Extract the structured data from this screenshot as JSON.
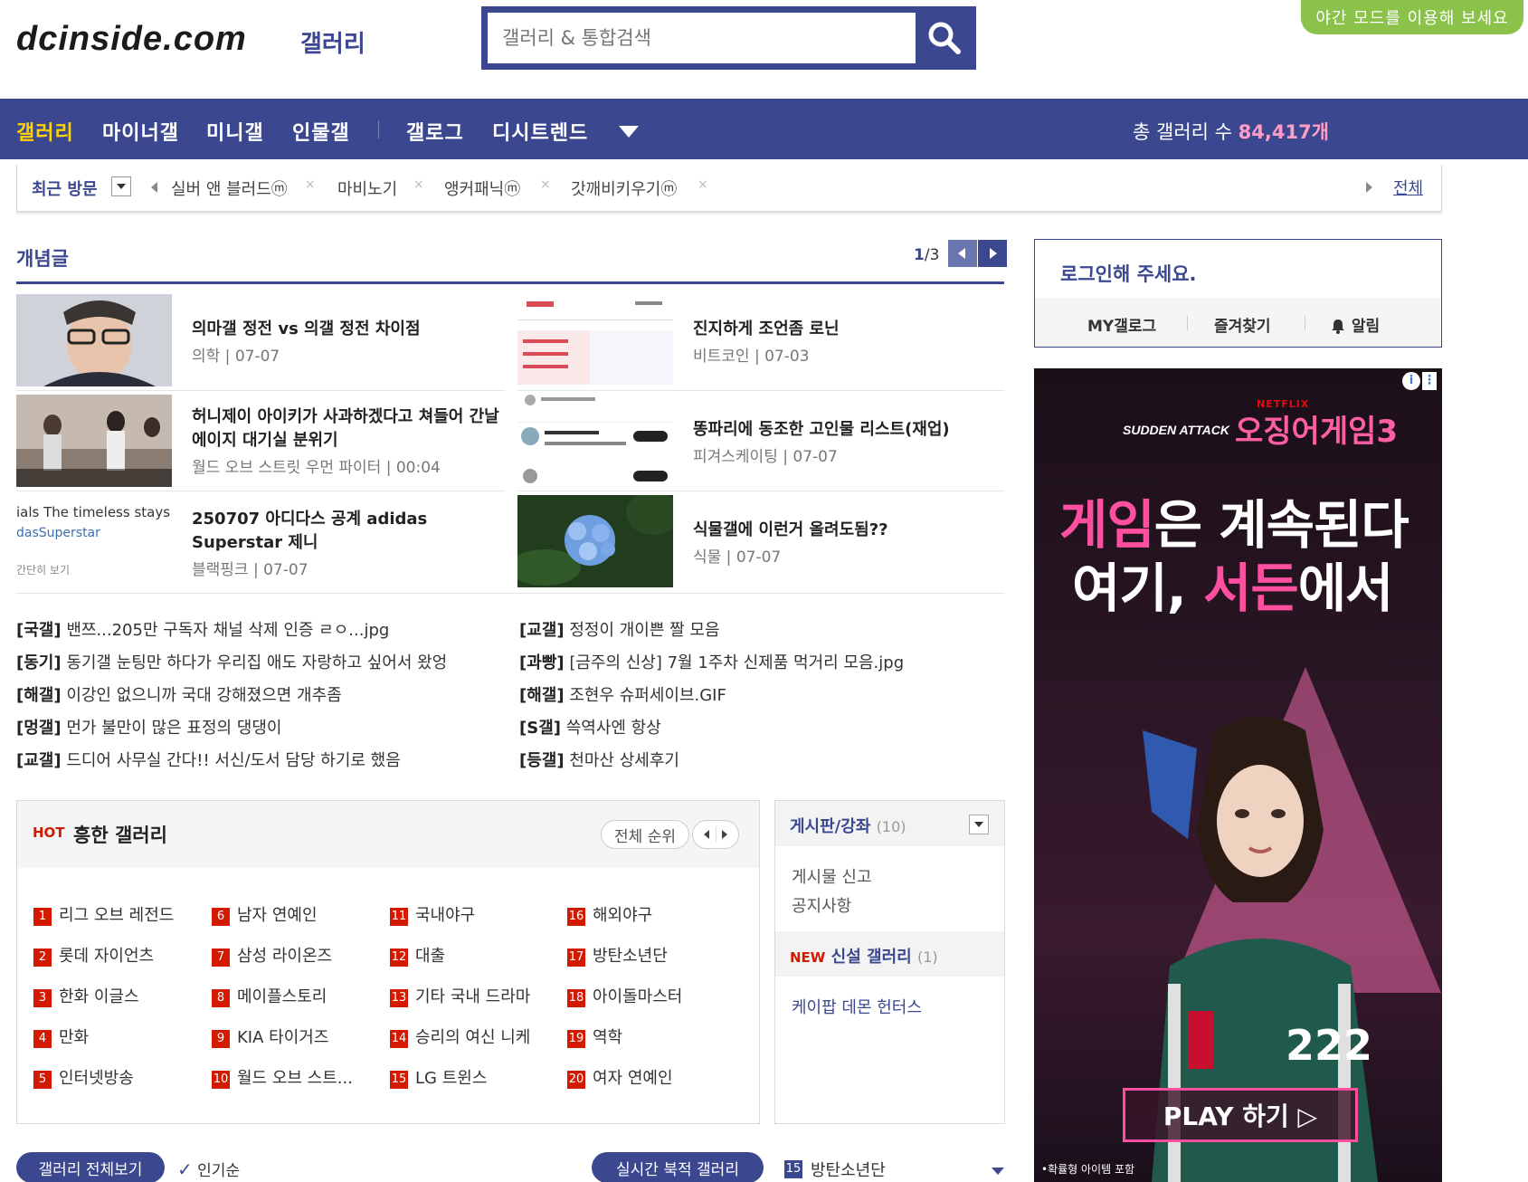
{
  "header": {
    "logo": "dcinside.com",
    "logo_sub": "갤러리",
    "search_placeholder": "갤러리 & 통합검색",
    "night_mode": "야간 모드를 이용해 보세요"
  },
  "nav": {
    "items": [
      "갤러리",
      "마이너갤",
      "미니갤",
      "인물갤",
      "갤로그",
      "디시트렌드"
    ],
    "total_label": "총 갤러리 수",
    "total_count": "84,417개"
  },
  "recent": {
    "label": "최근 방문",
    "items": [
      "실버 앤 블러드ⓜ",
      "마비노기",
      "앵커패닉ⓜ",
      "갓깨비키우기ⓜ"
    ],
    "remove": "×",
    "all": "전체"
  },
  "concept": {
    "title": "개념글",
    "page_current": "1",
    "page_total": "/3",
    "cards": [
      {
        "title": "의마갤 정전 vs 의갤 정전 차이점",
        "gallery": "의학",
        "date": "07-07"
      },
      {
        "title": "진지하게 조언좀 로닌",
        "gallery": "비트코인",
        "date": "07-03"
      },
      {
        "title": "허니제이 아이키가 사과하겠다고 쳐들어 간날 에이지 대기실 분위기",
        "gallery": "월드 오브 스트릿 우먼 파이터",
        "date": "00:04"
      },
      {
        "title": "똥파리에 동조한 고인물 리스트(재업)",
        "gallery": "피겨스케이팅",
        "date": "07-07"
      },
      {
        "title": "250707 아디다스 공계 adidas Superstar 제니",
        "gallery": "블랙핑크",
        "date": "07-07"
      },
      {
        "title": "식물갤에 이런거 올려도됨??",
        "gallery": "식물",
        "date": "07-07"
      }
    ],
    "thumb_texts": {
      "adidas_line1": "ials The timeless stays",
      "adidas_line2": "dasSuperstar",
      "adidas_line3": "간단히 보기"
    },
    "list_left": [
      {
        "tag": "[국갤]",
        "text": "밴쯔...205만 구독자 채널 삭제 인증 ㄹㅇ...jpg"
      },
      {
        "tag": "[동기]",
        "text": "동기갤 눈팅만 하다가 우리집 애도 자랑하고 싶어서 왔엉"
      },
      {
        "tag": "[해갤]",
        "text": "이강인 없으니까 국대 강해졌으면 개추좀"
      },
      {
        "tag": "[멍갤]",
        "text": "먼가 불만이 많은 표정의 댕댕이"
      },
      {
        "tag": "[교갤]",
        "text": "드디어 사무실 간다!! 서신/도서 담당 하기로 했음"
      }
    ],
    "list_right": [
      {
        "tag": "[교갤]",
        "text": "정정이 개이쁜 짤 모음"
      },
      {
        "tag": "[과빵]",
        "text": "[금주의 신상] 7월 1주차 신제품 먹거리 모음.jpg"
      },
      {
        "tag": "[해갤]",
        "text": "조현우 슈퍼세이브.GIF"
      },
      {
        "tag": "[S갤]",
        "text": "쓱역사엔 항상"
      },
      {
        "tag": "[등갤]",
        "text": "천마산 상세후기"
      }
    ]
  },
  "hot": {
    "tag": "HOT",
    "title": "흥한 갤러리",
    "all_rank": "전체 순위",
    "ranks": [
      {
        "n": "1",
        "name": "리그 오브 레전드"
      },
      {
        "n": "2",
        "name": "롯데 자이언츠"
      },
      {
        "n": "3",
        "name": "한화 이글스"
      },
      {
        "n": "4",
        "name": "만화"
      },
      {
        "n": "5",
        "name": "인터넷방송"
      },
      {
        "n": "6",
        "name": "남자 연예인"
      },
      {
        "n": "7",
        "name": "삼성 라이온즈"
      },
      {
        "n": "8",
        "name": "메이플스토리"
      },
      {
        "n": "9",
        "name": "KIA 타이거즈"
      },
      {
        "n": "10",
        "name": "월드 오브 스트..."
      },
      {
        "n": "11",
        "name": "국내야구"
      },
      {
        "n": "12",
        "name": "대출"
      },
      {
        "n": "13",
        "name": "기타 국내 드라마"
      },
      {
        "n": "14",
        "name": "승리의 여신 니케"
      },
      {
        "n": "15",
        "name": "LG 트윈스"
      },
      {
        "n": "16",
        "name": "해외야구"
      },
      {
        "n": "17",
        "name": "방탄소년단"
      },
      {
        "n": "18",
        "name": "아이돌마스터"
      },
      {
        "n": "19",
        "name": "역학"
      },
      {
        "n": "20",
        "name": "여자 연예인"
      }
    ]
  },
  "board": {
    "title": "게시판/강좌",
    "count": "(10)",
    "links": [
      "게시물 신고",
      "공지사항"
    ],
    "new_tag": "NEW",
    "new_title": "신설 갤러리",
    "new_count": "(1)",
    "new_links": [
      "케이팝 데몬 헌터스"
    ]
  },
  "bottom": {
    "all_gallery": "갤러리 전체보기",
    "check": "✓",
    "popular": "인기순",
    "realtime": "실시간 북적 갤러리",
    "realtime_rank": "15",
    "realtime_name": "방탄소년단"
  },
  "login": {
    "title": "로그인해 주세요.",
    "links": [
      "MY갤로그",
      "즐겨찾기",
      "알림"
    ]
  },
  "ad": {
    "info": "i",
    "dots": "⋮",
    "brand": "SUDDEN ATTACK",
    "netflix": "NETFLIX",
    "game": "오징어게임3",
    "line1_pink": "게임",
    "line1_rest": "은 계속된다",
    "line2_a": "여기, ",
    "line2_pink": "서든",
    "line2_b": "에서",
    "number": "222",
    "play": "PLAY 하기 ▷",
    "footnote": "•확률형 아이템 포함"
  },
  "colors": {
    "brand": "#3b4890",
    "hot_red": "#d31900",
    "night_green": "#8bc34a",
    "nav_active": "#ffd400"
  }
}
